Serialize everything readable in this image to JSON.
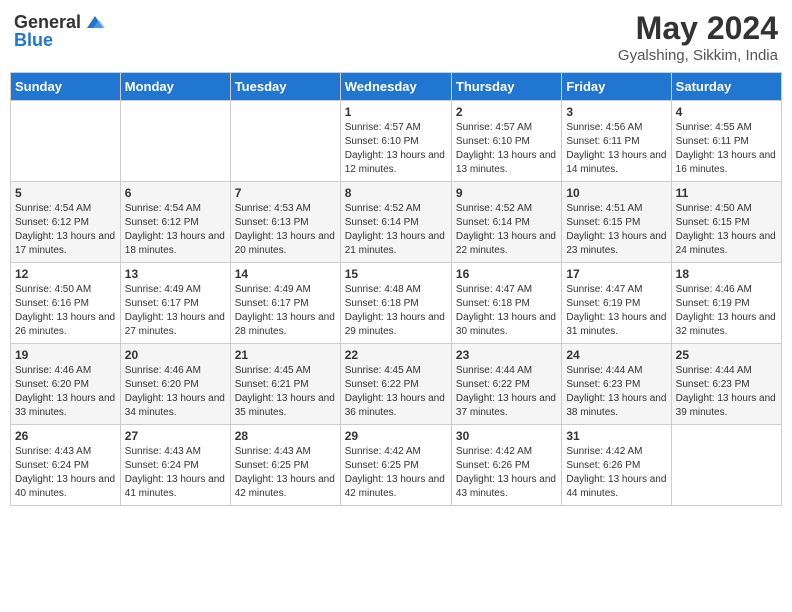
{
  "header": {
    "logo_general": "General",
    "logo_blue": "Blue",
    "title": "May 2024",
    "subtitle": "Gyalshing, Sikkim, India"
  },
  "weekdays": [
    "Sunday",
    "Monday",
    "Tuesday",
    "Wednesday",
    "Thursday",
    "Friday",
    "Saturday"
  ],
  "weeks": [
    [
      {
        "day": "",
        "info": ""
      },
      {
        "day": "",
        "info": ""
      },
      {
        "day": "",
        "info": ""
      },
      {
        "day": "1",
        "info": "Sunrise: 4:57 AM\nSunset: 6:10 PM\nDaylight: 13 hours and 12 minutes."
      },
      {
        "day": "2",
        "info": "Sunrise: 4:57 AM\nSunset: 6:10 PM\nDaylight: 13 hours and 13 minutes."
      },
      {
        "day": "3",
        "info": "Sunrise: 4:56 AM\nSunset: 6:11 PM\nDaylight: 13 hours and 14 minutes."
      },
      {
        "day": "4",
        "info": "Sunrise: 4:55 AM\nSunset: 6:11 PM\nDaylight: 13 hours and 16 minutes."
      }
    ],
    [
      {
        "day": "5",
        "info": "Sunrise: 4:54 AM\nSunset: 6:12 PM\nDaylight: 13 hours and 17 minutes."
      },
      {
        "day": "6",
        "info": "Sunrise: 4:54 AM\nSunset: 6:12 PM\nDaylight: 13 hours and 18 minutes."
      },
      {
        "day": "7",
        "info": "Sunrise: 4:53 AM\nSunset: 6:13 PM\nDaylight: 13 hours and 20 minutes."
      },
      {
        "day": "8",
        "info": "Sunrise: 4:52 AM\nSunset: 6:14 PM\nDaylight: 13 hours and 21 minutes."
      },
      {
        "day": "9",
        "info": "Sunrise: 4:52 AM\nSunset: 6:14 PM\nDaylight: 13 hours and 22 minutes."
      },
      {
        "day": "10",
        "info": "Sunrise: 4:51 AM\nSunset: 6:15 PM\nDaylight: 13 hours and 23 minutes."
      },
      {
        "day": "11",
        "info": "Sunrise: 4:50 AM\nSunset: 6:15 PM\nDaylight: 13 hours and 24 minutes."
      }
    ],
    [
      {
        "day": "12",
        "info": "Sunrise: 4:50 AM\nSunset: 6:16 PM\nDaylight: 13 hours and 26 minutes."
      },
      {
        "day": "13",
        "info": "Sunrise: 4:49 AM\nSunset: 6:17 PM\nDaylight: 13 hours and 27 minutes."
      },
      {
        "day": "14",
        "info": "Sunrise: 4:49 AM\nSunset: 6:17 PM\nDaylight: 13 hours and 28 minutes."
      },
      {
        "day": "15",
        "info": "Sunrise: 4:48 AM\nSunset: 6:18 PM\nDaylight: 13 hours and 29 minutes."
      },
      {
        "day": "16",
        "info": "Sunrise: 4:47 AM\nSunset: 6:18 PM\nDaylight: 13 hours and 30 minutes."
      },
      {
        "day": "17",
        "info": "Sunrise: 4:47 AM\nSunset: 6:19 PM\nDaylight: 13 hours and 31 minutes."
      },
      {
        "day": "18",
        "info": "Sunrise: 4:46 AM\nSunset: 6:19 PM\nDaylight: 13 hours and 32 minutes."
      }
    ],
    [
      {
        "day": "19",
        "info": "Sunrise: 4:46 AM\nSunset: 6:20 PM\nDaylight: 13 hours and 33 minutes."
      },
      {
        "day": "20",
        "info": "Sunrise: 4:46 AM\nSunset: 6:20 PM\nDaylight: 13 hours and 34 minutes."
      },
      {
        "day": "21",
        "info": "Sunrise: 4:45 AM\nSunset: 6:21 PM\nDaylight: 13 hours and 35 minutes."
      },
      {
        "day": "22",
        "info": "Sunrise: 4:45 AM\nSunset: 6:22 PM\nDaylight: 13 hours and 36 minutes."
      },
      {
        "day": "23",
        "info": "Sunrise: 4:44 AM\nSunset: 6:22 PM\nDaylight: 13 hours and 37 minutes."
      },
      {
        "day": "24",
        "info": "Sunrise: 4:44 AM\nSunset: 6:23 PM\nDaylight: 13 hours and 38 minutes."
      },
      {
        "day": "25",
        "info": "Sunrise: 4:44 AM\nSunset: 6:23 PM\nDaylight: 13 hours and 39 minutes."
      }
    ],
    [
      {
        "day": "26",
        "info": "Sunrise: 4:43 AM\nSunset: 6:24 PM\nDaylight: 13 hours and 40 minutes."
      },
      {
        "day": "27",
        "info": "Sunrise: 4:43 AM\nSunset: 6:24 PM\nDaylight: 13 hours and 41 minutes."
      },
      {
        "day": "28",
        "info": "Sunrise: 4:43 AM\nSunset: 6:25 PM\nDaylight: 13 hours and 42 minutes."
      },
      {
        "day": "29",
        "info": "Sunrise: 4:42 AM\nSunset: 6:25 PM\nDaylight: 13 hours and 42 minutes."
      },
      {
        "day": "30",
        "info": "Sunrise: 4:42 AM\nSunset: 6:26 PM\nDaylight: 13 hours and 43 minutes."
      },
      {
        "day": "31",
        "info": "Sunrise: 4:42 AM\nSunset: 6:26 PM\nDaylight: 13 hours and 44 minutes."
      },
      {
        "day": "",
        "info": ""
      }
    ]
  ]
}
